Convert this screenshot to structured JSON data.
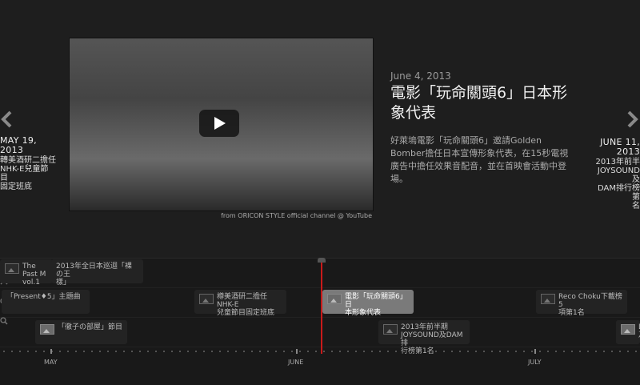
{
  "prev_slide": {
    "date": "MAY 19,\n2013",
    "desc": "轉美酒研二擔任\nNHK-E兒童節目\n固定班底"
  },
  "next_slide": {
    "date": "JUNE 11,\n2013",
    "desc": "2013年前半\nJOYSOUND及\nDAM排行榜第\n名"
  },
  "main": {
    "date": "June 4, 2013",
    "title": "電影「玩命關頭6」日本形象代表",
    "desc": "好萊塢電影「玩命關頭6」邀請Golden Bomber擔任日本宣傳形象代表，在15秒電視廣告中擔任效果音配音，並在首映會活動中登場。",
    "credit": "from ORICON STYLE official channel @ YouTube"
  },
  "timeline": {
    "markers": [
      {
        "label": "The Past M\nvol.1",
        "photo": false
      },
      {
        "label": "2013年全日本巡迴「裸の王\n樣」",
        "photo": false
      },
      {
        "label": "「Present♦5」主題曲",
        "photo": false
      },
      {
        "label": "樽美酒研二擔任NHK-E\n兒童節目固定班底",
        "photo": false
      },
      {
        "label": "電影「玩命關頭6」日\n本形象代表",
        "photo": true
      },
      {
        "label": "Reco Choku下載榜5\n項第1名",
        "photo": false
      },
      {
        "label": "「徹子の部屋」節目",
        "photo": true
      },
      {
        "label": "2013年前半期\nJOYSOUND及DAM排\n行榜第1名",
        "photo": false
      },
      {
        "label": "L\n及",
        "photo": true
      }
    ],
    "months": [
      "MAY",
      "JUNE",
      "JULY"
    ],
    "accent": "#c91a1a"
  },
  "icons": [
    "chevron-left-icon",
    "chevron-right-icon",
    "play-icon",
    "zoom-in-icon",
    "zoom-out-icon",
    "image-icon"
  ]
}
